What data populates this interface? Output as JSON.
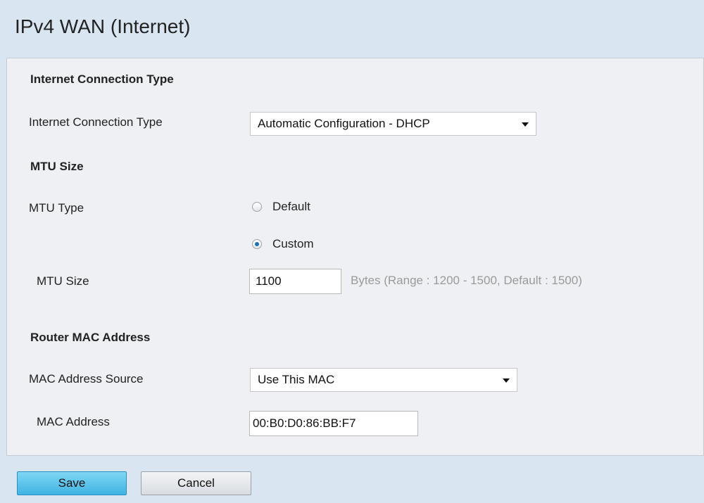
{
  "page": {
    "title": "IPv4 WAN (Internet)"
  },
  "connection": {
    "heading": "Internet Connection Type",
    "label": "Internet Connection Type",
    "selected": "Automatic Configuration - DHCP"
  },
  "mtu": {
    "heading": "MTU Size",
    "type_label": "MTU Type",
    "option_default": "Default",
    "option_custom": "Custom",
    "selected_option": "Custom",
    "size_label": "MTU Size",
    "size_value": "1100",
    "size_hint": "Bytes (Range : 1200 - 1500, Default : 1500)"
  },
  "mac": {
    "heading": "Router MAC Address",
    "source_label": "MAC Address Source",
    "source_selected": "Use This MAC",
    "address_label": "MAC Address",
    "address_value": "00:B0:D0:86:BB:F7"
  },
  "actions": {
    "save_label": "Save",
    "cancel_label": "Cancel"
  },
  "colors": {
    "background": "#d9e6f2",
    "panel": "#eef0f3",
    "save_button": "#3fb4e3",
    "radio_selected": "#1f6fb8"
  }
}
